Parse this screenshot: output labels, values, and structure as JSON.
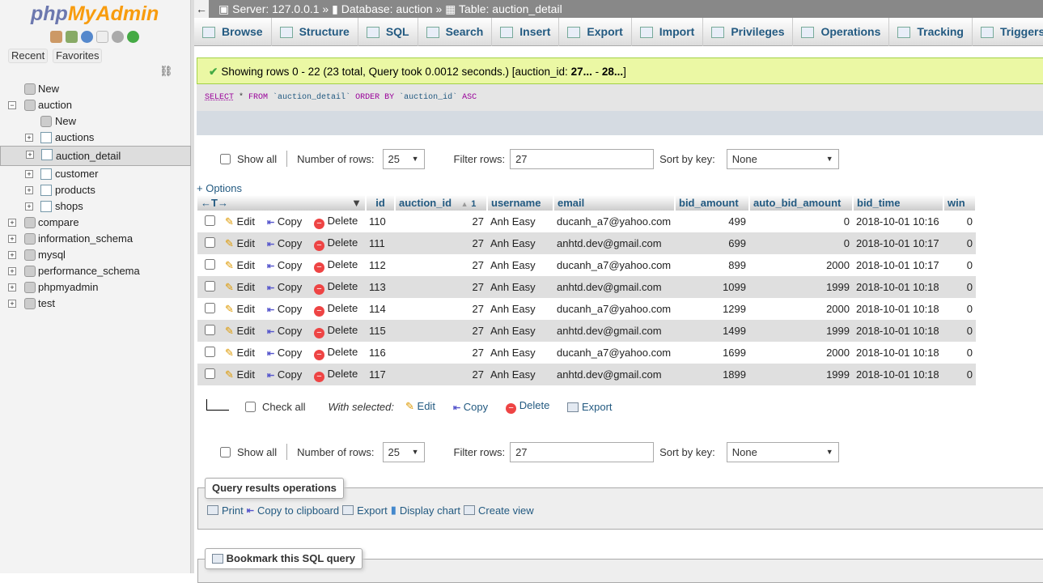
{
  "sidebar": {
    "logo_php": "php",
    "logo_myadmin": "MyAdmin",
    "recent": "Recent",
    "favorites": "Favorites",
    "tree": [
      {
        "label": "New",
        "level": 0,
        "type": "new"
      },
      {
        "label": "auction",
        "level": 0,
        "type": "db",
        "expanded": true
      },
      {
        "label": "New",
        "level": 1,
        "type": "new"
      },
      {
        "label": "auctions",
        "level": 1,
        "type": "table"
      },
      {
        "label": "auction_detail",
        "level": 1,
        "type": "table",
        "selected": true
      },
      {
        "label": "customer",
        "level": 1,
        "type": "table"
      },
      {
        "label": "products",
        "level": 1,
        "type": "table"
      },
      {
        "label": "shops",
        "level": 1,
        "type": "table"
      },
      {
        "label": "compare",
        "level": 0,
        "type": "db"
      },
      {
        "label": "information_schema",
        "level": 0,
        "type": "db"
      },
      {
        "label": "mysql",
        "level": 0,
        "type": "db"
      },
      {
        "label": "performance_schema",
        "level": 0,
        "type": "db"
      },
      {
        "label": "phpmyadmin",
        "level": 0,
        "type": "db"
      },
      {
        "label": "test",
        "level": 0,
        "type": "db"
      }
    ]
  },
  "breadcrumb": {
    "server": "Server: 127.0.0.1",
    "database": "Database: auction",
    "table": "Table: auction_detail",
    "sep": "»"
  },
  "tabs": [
    "Browse",
    "Structure",
    "SQL",
    "Search",
    "Insert",
    "Export",
    "Import",
    "Privileges",
    "Operations",
    "Tracking",
    "Triggers"
  ],
  "message": {
    "text": "Showing rows 0 - 22 (23 total, Query took 0.0012 seconds.) [auction_id: ",
    "from": "27...",
    "dash": " - ",
    "to": "28...",
    "end": "]"
  },
  "sql": {
    "select": "SELECT",
    "rest1": " * ",
    "from": "FROM",
    "table": " `auction_detail` ",
    "order": "ORDER BY",
    "col": " `auction_id` ",
    "asc": "ASC"
  },
  "nav": {
    "show_all": "Show all",
    "rows_label": "Number of rows:",
    "rows_value": "25",
    "filter_label": "Filter rows:",
    "filter_value": "27",
    "sort_label": "Sort by key:",
    "sort_value": "None"
  },
  "options_label": "+ Options",
  "columns": [
    "id",
    "auction_id",
    "username",
    "email",
    "bid_amount",
    "auto_bid_amount",
    "bid_time",
    "win"
  ],
  "sort_indicator": "1",
  "actions": {
    "edit": "Edit",
    "copy": "Copy",
    "delete": "Delete"
  },
  "rows": [
    [
      "110",
      "27",
      "Anh Easy",
      "ducanh_a7@yahoo.com",
      "499",
      "0",
      "2018-10-01 10:16",
      "0"
    ],
    [
      "111",
      "27",
      "Anh Easy",
      "anhtd.dev@gmail.com",
      "699",
      "0",
      "2018-10-01 10:17",
      "0"
    ],
    [
      "112",
      "27",
      "Anh Easy",
      "ducanh_a7@yahoo.com",
      "899",
      "2000",
      "2018-10-01 10:17",
      "0"
    ],
    [
      "113",
      "27",
      "Anh Easy",
      "anhtd.dev@gmail.com",
      "1099",
      "1999",
      "2018-10-01 10:18",
      "0"
    ],
    [
      "114",
      "27",
      "Anh Easy",
      "ducanh_a7@yahoo.com",
      "1299",
      "2000",
      "2018-10-01 10:18",
      "0"
    ],
    [
      "115",
      "27",
      "Anh Easy",
      "anhtd.dev@gmail.com",
      "1499",
      "1999",
      "2018-10-01 10:18",
      "0"
    ],
    [
      "116",
      "27",
      "Anh Easy",
      "ducanh_a7@yahoo.com",
      "1699",
      "2000",
      "2018-10-01 10:18",
      "0"
    ],
    [
      "117",
      "27",
      "Anh Easy",
      "anhtd.dev@gmail.com",
      "1899",
      "1999",
      "2018-10-01 10:18",
      "0"
    ]
  ],
  "bulk": {
    "check_all": "Check all",
    "with_selected": "With selected:",
    "edit": "Edit",
    "copy": "Copy",
    "delete": "Delete",
    "export": "Export"
  },
  "query_ops": {
    "title": "Query results operations",
    "print": "Print",
    "copy": "Copy to clipboard",
    "export": "Export",
    "chart": "Display chart",
    "view": "Create view"
  },
  "bookmark": {
    "title": "Bookmark this SQL query"
  }
}
